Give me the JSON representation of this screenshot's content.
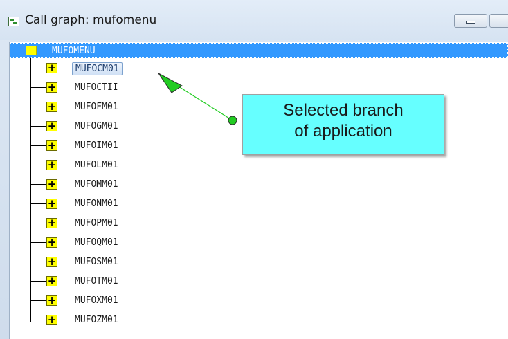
{
  "window": {
    "title": "Call graph: mufomenu",
    "title_icon": "callgraph-icon",
    "buttons": [
      "minimize-icon",
      "maximize-icon"
    ]
  },
  "tree": {
    "root": {
      "label": "MUFOMENU",
      "icon": "module-icon",
      "selected": true
    },
    "children": [
      {
        "label": "MUFOCM01",
        "selected": true
      },
      {
        "label": "MUFOCTII"
      },
      {
        "label": "MUFOFM01"
      },
      {
        "label": "MUFOGM01"
      },
      {
        "label": "MUFOIM01"
      },
      {
        "label": "MUFOLM01"
      },
      {
        "label": "MUFOMM01"
      },
      {
        "label": "MUFONM01"
      },
      {
        "label": "MUFOPM01"
      },
      {
        "label": "MUFOQM01"
      },
      {
        "label": "MUFOSM01"
      },
      {
        "label": "MUFOTM01"
      },
      {
        "label": "MUFOXM01"
      },
      {
        "label": "MUFOZM01"
      }
    ],
    "expander_glyph": "+"
  },
  "callout": {
    "line1": "Selected branch",
    "line2": "of application",
    "fill_color": "#66ffff",
    "arrow_color": "#22cc22"
  },
  "colors": {
    "selection": "#3399ff",
    "expander": "#ffff00"
  }
}
